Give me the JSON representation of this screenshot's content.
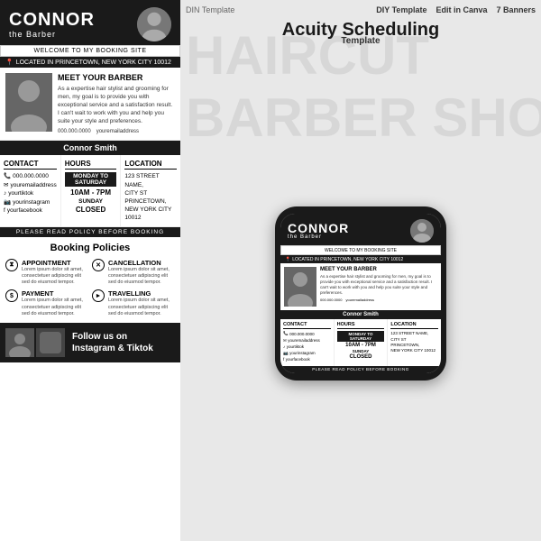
{
  "template": {
    "name": "DIN Template",
    "tags": [
      "DIY Template",
      "Edit in Canva",
      "7 Banners"
    ],
    "main_title": "Acuity Scheduling",
    "main_title2": "Template"
  },
  "barber": {
    "first_name": "CONNOR",
    "title": "the Barber",
    "full_name": "Connor Smith",
    "welcome": "WELCOME TO MY BOOKING SITE",
    "location": "LOCATED IN PRINCETOWN, NEW YORK CITY 10012",
    "meet_section": "MEET YOUR BARBER",
    "description": "As a expertise hair stylist and grooming for men, my goal is to provide you with exceptional service and a satisfaction result. I can't wait to work with you and help you suite your style and preferences.",
    "phone": "000.000.0000",
    "email": "youremailaddress"
  },
  "contact": {
    "title": "Contact",
    "phone": "000.000.0000",
    "email": "youremailaddress",
    "tiktok": "yourtiktok",
    "instagram": "yourinstagram",
    "facebook": "yourfacebook"
  },
  "hours": {
    "title": "Hours",
    "weekday_range": "MONDAY TO SATURDAY",
    "time": "10AM - 7PM",
    "sunday_label": "SUNDAY",
    "sunday_status": "CLOSED"
  },
  "location": {
    "title": "Location",
    "address1": "123 STREET NAME,",
    "address2": "CITY ST",
    "city": "PRINCETOWN,",
    "zip": "NEW YORK CITY 10012"
  },
  "policies": {
    "section_title": "Booking Policies",
    "read_label": "PLEASE READ POLICY BEFORE BOOKING",
    "items": [
      {
        "label": "APPOINTMENT",
        "desc": "Lorem ipsum dolor sit amet, consectetuer adipiscing elit sed do eiusmod tempor."
      },
      {
        "label": "CANCELLATION",
        "desc": "Lorem ipsum dolor sit amet, consectetuer adipiscing elit sed do eiusmod tempor."
      },
      {
        "label": "PAYMENT",
        "desc": "Lorem ipsum dolor sit amet, consectetuer adipiscing elit sed do eiusmod tempor."
      },
      {
        "label": "TRAVELLING",
        "desc": "Lorem ipsum dolor sit amet, consectetuer adipiscing elit sed do eiusmod tempor."
      }
    ]
  },
  "follow": {
    "text": "Follow us on",
    "text2": "Instagram & Tiktok"
  }
}
